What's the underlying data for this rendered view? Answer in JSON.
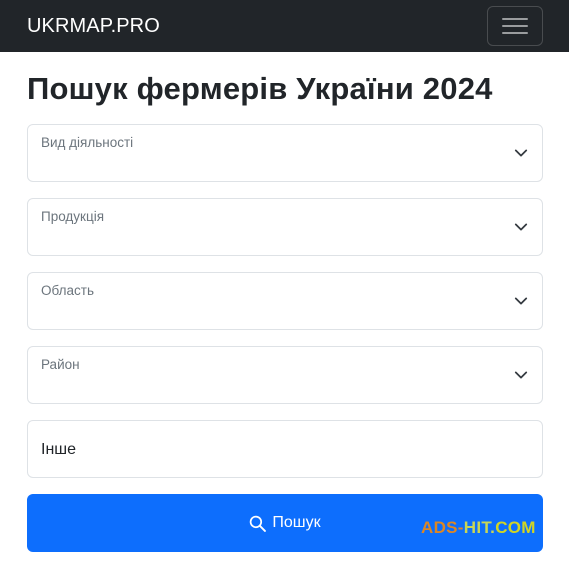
{
  "navbar": {
    "brand": "UKRMAP.PRO",
    "toggler_icon": "hamburger-icon"
  },
  "page": {
    "title": "Пошук фермерів України 2024"
  },
  "form": {
    "activity": {
      "label": "Вид діяльності",
      "icon": "chevron-down-icon"
    },
    "product": {
      "label": "Продукція",
      "icon": "chevron-down-icon"
    },
    "region": {
      "label": "Область",
      "icon": "chevron-down-icon"
    },
    "district": {
      "label": "Район",
      "icon": "chevron-down-icon"
    },
    "other": {
      "value": "Інше"
    },
    "search_button": {
      "label": "Пошук",
      "icon": "search-icon"
    }
  },
  "watermark": {
    "part1": "ADS-",
    "part2": "HIT.",
    "part3": "COM"
  },
  "colors": {
    "navbar_bg": "#212529",
    "primary": "#0d6efd",
    "border": "#dee2e6",
    "muted_text": "#6c757d"
  }
}
